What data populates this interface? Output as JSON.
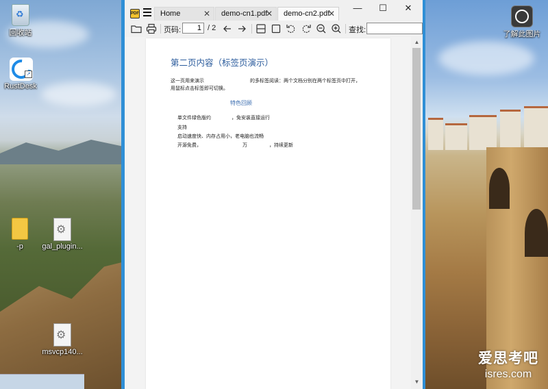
{
  "desktop": {
    "icons": [
      {
        "label": "回收站"
      },
      {
        "label": "RustDesk"
      },
      {
        "label": "-p"
      },
      {
        "label": "gal_plugin..."
      },
      {
        "label": "msvcp140..."
      },
      {
        "label": "了解此图片"
      }
    ],
    "watermark": {
      "line1": "爱思考吧",
      "line2": "isres.com"
    }
  },
  "window": {
    "app_icon_text": "PDF",
    "tabs": [
      {
        "label": "Home",
        "close": "✕"
      },
      {
        "label": "demo-cn1.pdf",
        "close": "✕"
      },
      {
        "label": "demo-cn2.pdf",
        "close": "✕"
      }
    ],
    "active_tab": 2,
    "controls": {
      "minimize": "—",
      "maximize": "☐",
      "close": "✕"
    }
  },
  "toolbar": {
    "page_label": "页码:",
    "page_value": "1",
    "page_total": "/ 2",
    "search_label": "查找:",
    "search_value": ""
  },
  "document": {
    "title": "第二页内容（标签页演示）",
    "paragraph_line1a": "这一页用来演示",
    "paragraph_line1b": "的多标签阅读：两个文档分别在两个标签页中打开，",
    "paragraph_line2": "用鼠标点击标签即可切换。",
    "section_title": "特色回顾",
    "bullets": [
      {
        "a": "单文件绿色版约",
        "b": "，免安装直接运行"
      },
      {
        "a": "支持",
        "b": ""
      },
      {
        "a": "启动速度快、内存占用小，老电脑也流畅",
        "b": ""
      },
      {
        "a": "开源免费，",
        "b": "万",
        "c": "，持续更新"
      }
    ]
  },
  "scrollbar": {
    "up": "▲",
    "down": "▼"
  }
}
